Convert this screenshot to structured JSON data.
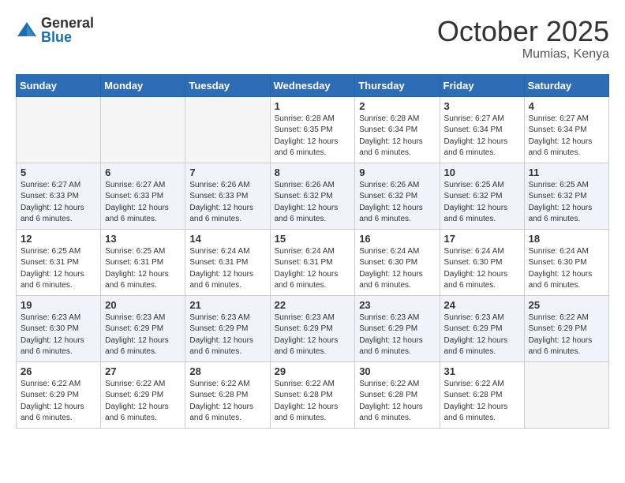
{
  "logo": {
    "general": "General",
    "blue": "Blue"
  },
  "title": "October 2025",
  "location": "Mumias, Kenya",
  "days_of_week": [
    "Sunday",
    "Monday",
    "Tuesday",
    "Wednesday",
    "Thursday",
    "Friday",
    "Saturday"
  ],
  "weeks": [
    [
      {
        "num": "",
        "info": ""
      },
      {
        "num": "",
        "info": ""
      },
      {
        "num": "",
        "info": ""
      },
      {
        "num": "1",
        "info": "Sunrise: 6:28 AM\nSunset: 6:35 PM\nDaylight: 12 hours and 6 minutes."
      },
      {
        "num": "2",
        "info": "Sunrise: 6:28 AM\nSunset: 6:34 PM\nDaylight: 12 hours and 6 minutes."
      },
      {
        "num": "3",
        "info": "Sunrise: 6:27 AM\nSunset: 6:34 PM\nDaylight: 12 hours and 6 minutes."
      },
      {
        "num": "4",
        "info": "Sunrise: 6:27 AM\nSunset: 6:34 PM\nDaylight: 12 hours and 6 minutes."
      }
    ],
    [
      {
        "num": "5",
        "info": "Sunrise: 6:27 AM\nSunset: 6:33 PM\nDaylight: 12 hours and 6 minutes."
      },
      {
        "num": "6",
        "info": "Sunrise: 6:27 AM\nSunset: 6:33 PM\nDaylight: 12 hours and 6 minutes."
      },
      {
        "num": "7",
        "info": "Sunrise: 6:26 AM\nSunset: 6:33 PM\nDaylight: 12 hours and 6 minutes."
      },
      {
        "num": "8",
        "info": "Sunrise: 6:26 AM\nSunset: 6:32 PM\nDaylight: 12 hours and 6 minutes."
      },
      {
        "num": "9",
        "info": "Sunrise: 6:26 AM\nSunset: 6:32 PM\nDaylight: 12 hours and 6 minutes."
      },
      {
        "num": "10",
        "info": "Sunrise: 6:25 AM\nSunset: 6:32 PM\nDaylight: 12 hours and 6 minutes."
      },
      {
        "num": "11",
        "info": "Sunrise: 6:25 AM\nSunset: 6:32 PM\nDaylight: 12 hours and 6 minutes."
      }
    ],
    [
      {
        "num": "12",
        "info": "Sunrise: 6:25 AM\nSunset: 6:31 PM\nDaylight: 12 hours and 6 minutes."
      },
      {
        "num": "13",
        "info": "Sunrise: 6:25 AM\nSunset: 6:31 PM\nDaylight: 12 hours and 6 minutes."
      },
      {
        "num": "14",
        "info": "Sunrise: 6:24 AM\nSunset: 6:31 PM\nDaylight: 12 hours and 6 minutes."
      },
      {
        "num": "15",
        "info": "Sunrise: 6:24 AM\nSunset: 6:31 PM\nDaylight: 12 hours and 6 minutes."
      },
      {
        "num": "16",
        "info": "Sunrise: 6:24 AM\nSunset: 6:30 PM\nDaylight: 12 hours and 6 minutes."
      },
      {
        "num": "17",
        "info": "Sunrise: 6:24 AM\nSunset: 6:30 PM\nDaylight: 12 hours and 6 minutes."
      },
      {
        "num": "18",
        "info": "Sunrise: 6:24 AM\nSunset: 6:30 PM\nDaylight: 12 hours and 6 minutes."
      }
    ],
    [
      {
        "num": "19",
        "info": "Sunrise: 6:23 AM\nSunset: 6:30 PM\nDaylight: 12 hours and 6 minutes."
      },
      {
        "num": "20",
        "info": "Sunrise: 6:23 AM\nSunset: 6:29 PM\nDaylight: 12 hours and 6 minutes."
      },
      {
        "num": "21",
        "info": "Sunrise: 6:23 AM\nSunset: 6:29 PM\nDaylight: 12 hours and 6 minutes."
      },
      {
        "num": "22",
        "info": "Sunrise: 6:23 AM\nSunset: 6:29 PM\nDaylight: 12 hours and 6 minutes."
      },
      {
        "num": "23",
        "info": "Sunrise: 6:23 AM\nSunset: 6:29 PM\nDaylight: 12 hours and 6 minutes."
      },
      {
        "num": "24",
        "info": "Sunrise: 6:23 AM\nSunset: 6:29 PM\nDaylight: 12 hours and 6 minutes."
      },
      {
        "num": "25",
        "info": "Sunrise: 6:22 AM\nSunset: 6:29 PM\nDaylight: 12 hours and 6 minutes."
      }
    ],
    [
      {
        "num": "26",
        "info": "Sunrise: 6:22 AM\nSunset: 6:29 PM\nDaylight: 12 hours and 6 minutes."
      },
      {
        "num": "27",
        "info": "Sunrise: 6:22 AM\nSunset: 6:29 PM\nDaylight: 12 hours and 6 minutes."
      },
      {
        "num": "28",
        "info": "Sunrise: 6:22 AM\nSunset: 6:28 PM\nDaylight: 12 hours and 6 minutes."
      },
      {
        "num": "29",
        "info": "Sunrise: 6:22 AM\nSunset: 6:28 PM\nDaylight: 12 hours and 6 minutes."
      },
      {
        "num": "30",
        "info": "Sunrise: 6:22 AM\nSunset: 6:28 PM\nDaylight: 12 hours and 6 minutes."
      },
      {
        "num": "31",
        "info": "Sunrise: 6:22 AM\nSunset: 6:28 PM\nDaylight: 12 hours and 6 minutes."
      },
      {
        "num": "",
        "info": ""
      }
    ]
  ]
}
